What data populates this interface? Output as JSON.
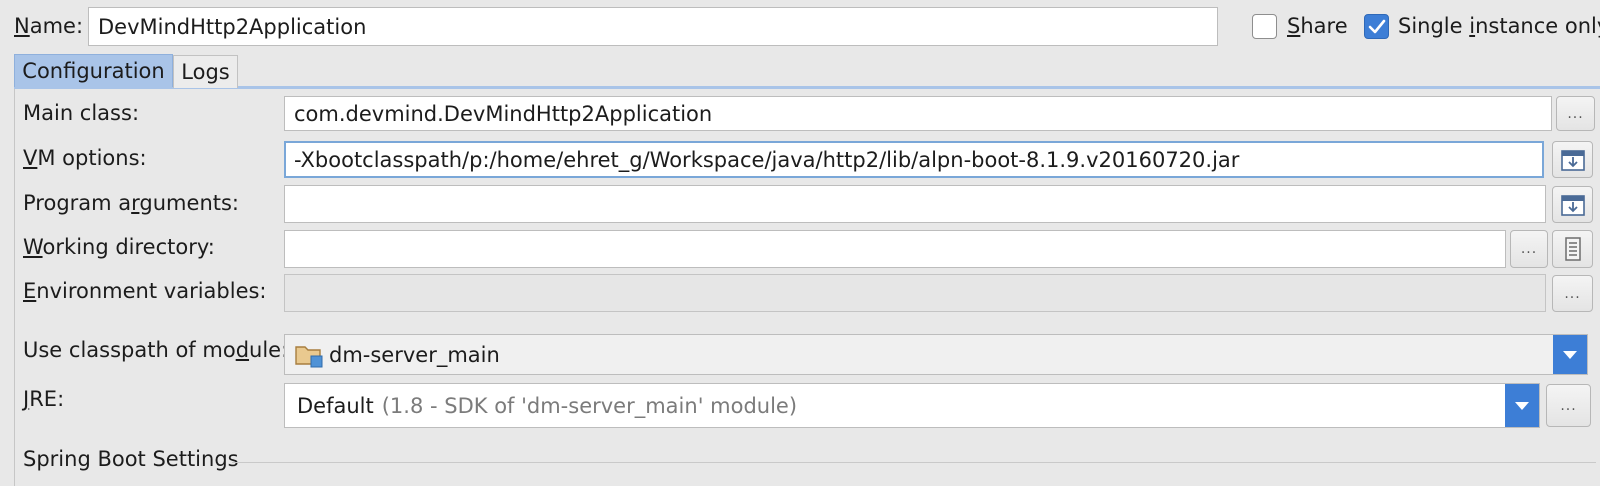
{
  "header": {
    "name_label": "Name:",
    "name_value": "DevMindHttp2Application",
    "share_label": "Share",
    "share_checked": false,
    "single_instance_label": "Single instance only",
    "single_instance_checked": true
  },
  "tabs": [
    {
      "label": "Configuration",
      "active": true
    },
    {
      "label": "Logs",
      "active": false
    }
  ],
  "form": {
    "main_class": {
      "label": "Main class:",
      "value": "com.devmind.DevMindHttp2Application"
    },
    "vm_options": {
      "label": "VM options:",
      "value": "-Xbootclasspath/p:/home/ehret_g/Workspace/java/http2/lib/alpn-boot-8.1.9.v20160720.jar"
    },
    "program_arguments": {
      "label": "Program arguments:",
      "value": ""
    },
    "working_directory": {
      "label": "Working directory:",
      "value": ""
    },
    "environment_variables": {
      "label": "Environment variables:",
      "value": ""
    },
    "classpath_module": {
      "label": "Use classpath of module:",
      "value": "dm-server_main"
    },
    "jre": {
      "label": "JRE:",
      "value": "Default",
      "detail": "(1.8 - SDK of 'dm-server_main' module)"
    }
  },
  "buttons": {
    "ellipsis": "..."
  },
  "sections": {
    "spring_boot": "Spring Boot Settings"
  },
  "icons": {
    "expand": "expand-field-icon",
    "folder": "folder-icon",
    "module": "module-folder-icon",
    "dropdown": "chevron-down-icon",
    "check": "checkmark-icon"
  },
  "colors": {
    "accent": "#3d7ed6",
    "tab_active": "#a9c4e8",
    "background": "#e8e8e8",
    "focus_border": "#7aa7d8"
  }
}
